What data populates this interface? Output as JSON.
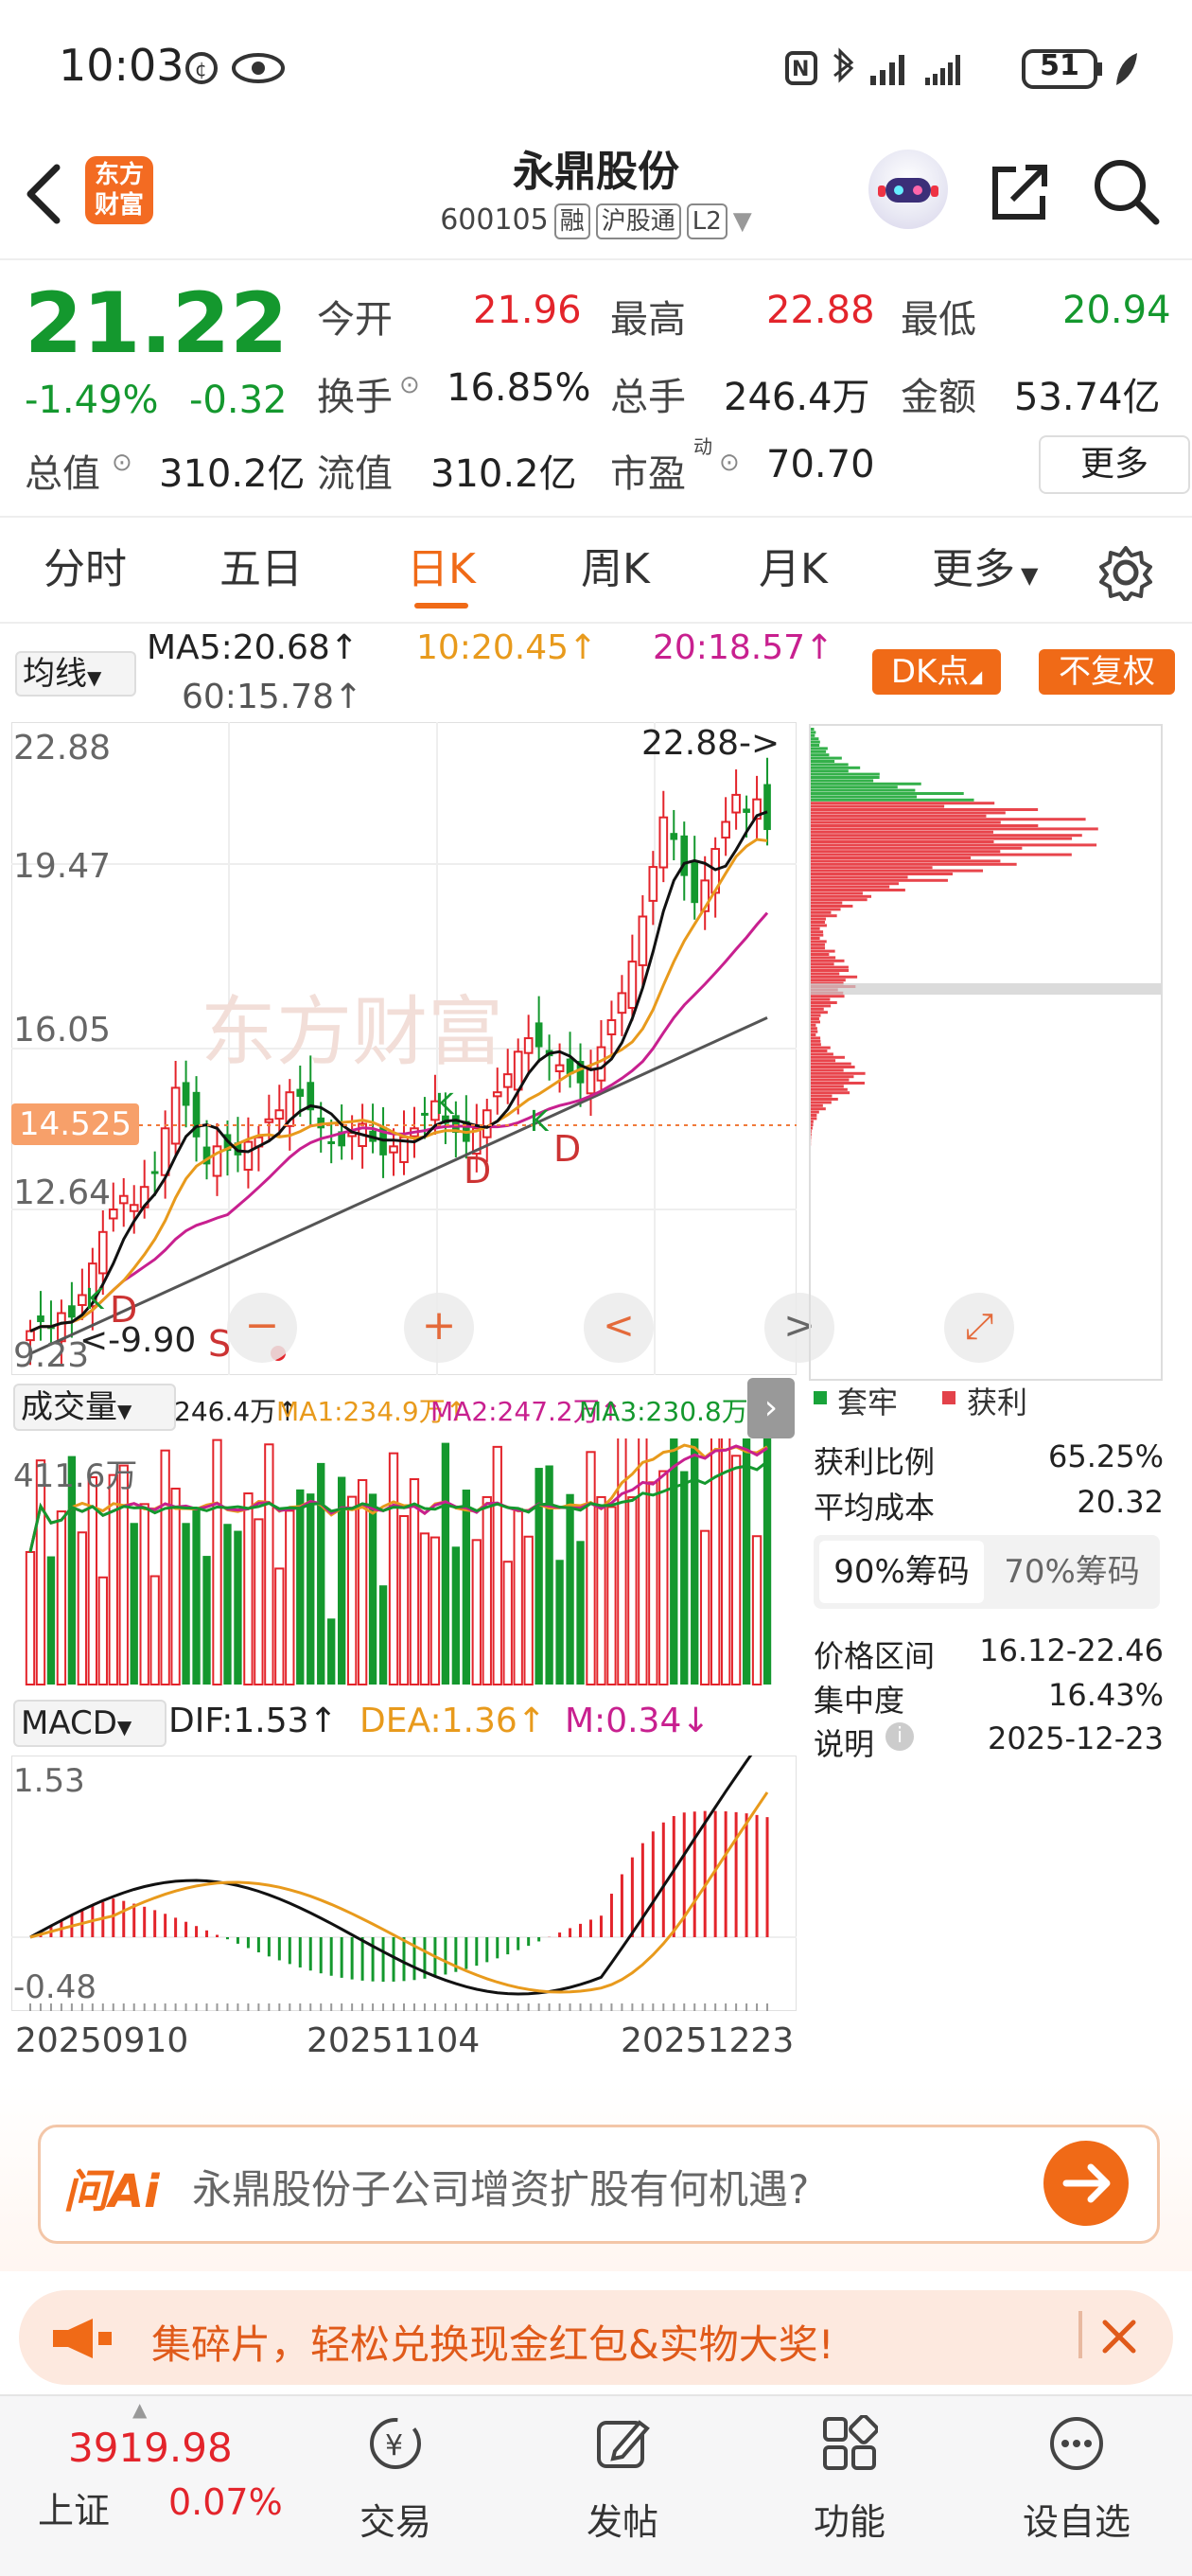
{
  "status": {
    "time": "10:03",
    "battery": "51"
  },
  "header": {
    "title": "永鼎股份",
    "code": "600105",
    "tags": [
      "融",
      "沪股通",
      "L2"
    ],
    "logo_text": "东方\n财富"
  },
  "quote": {
    "price": "21.22",
    "change_pct": "-1.49%",
    "change": "-0.32",
    "open_label": "今开",
    "open": "21.96",
    "high_label": "最高",
    "high": "22.88",
    "low_label": "最低",
    "low": "20.94",
    "turnover_label": "换手",
    "turnover": "16.85%",
    "volume_label": "总手",
    "volume": "246.4万",
    "amount_label": "金额",
    "amount": "53.74亿",
    "mktcap_label": "总值",
    "mktcap": "310.2亿",
    "float_label": "流值",
    "float_val": "310.2亿",
    "pe_label": "市盈",
    "pe_sup": "动",
    "pe": "70.70",
    "more_label": "更多"
  },
  "tabs": [
    "分时",
    "五日",
    "日K",
    "周K",
    "月K",
    "更多"
  ],
  "active_tab": "日K",
  "ma_legend": {
    "select": "均线",
    "ma5": "MA5:20.68↑",
    "ma10": "10:20.45↑",
    "ma20": "20:18.57↑",
    "ma60": "60:15.78↑",
    "dk_label": "DK点",
    "fq_label": "不复权"
  },
  "kline": {
    "y_labels": [
      "22.88",
      "19.47",
      "16.05",
      "12.64",
      "9.23"
    ],
    "current_marker": "14.525",
    "high_note": "22.88->",
    "low_note": "<-9.90",
    "signals": [
      "D",
      "D",
      "D",
      "K",
      "K",
      "K",
      "S"
    ],
    "controls": [
      "−",
      "+",
      "<",
      ">",
      "⤢"
    ]
  },
  "volume_legend": {
    "select": "成交量",
    "vol": "246.4万↑",
    "ma1": "MA1:234.9万↑",
    "ma2": "MA2:247.2万↑",
    "ma3": "MA3:230.8万↑",
    "max_label": "411.6万"
  },
  "macd_legend": {
    "select": "MACD",
    "dif": "DIF:1.53↑",
    "dea": "DEA:1.36↑",
    "m": "M:0.34↓",
    "top": "1.53",
    "bottom": "-0.48"
  },
  "x_dates": [
    "20250910",
    "20251104",
    "20251223"
  ],
  "chips": {
    "legend_trap": "套牢",
    "legend_profit": "获利",
    "profit_ratio_label": "获利比例",
    "profit_ratio": "65.25%",
    "avg_cost_label": "平均成本",
    "avg_cost": "20.32",
    "tab90": "90%筹码",
    "tab70": "70%筹码",
    "range_label": "价格区间",
    "range": "16.12-22.46",
    "conc_label": "集中度",
    "conc": "16.43%",
    "note_label": "说明",
    "note_date": "2025-12-23"
  },
  "ai": {
    "brand": "问Ai",
    "prompt": "永鼎股份子公司增资扩股有何机遇?"
  },
  "promo": {
    "text": "集碎片，轻松兑换现金红包&实物大奖!"
  },
  "bottom": {
    "index_value": "3919.98",
    "index_name": "上证",
    "index_change": "0.07%",
    "nav": [
      "交易",
      "发帖",
      "功能",
      "设自选"
    ]
  },
  "colors": {
    "up": "#e3242b",
    "down": "#14982e",
    "accent": "#f06a17",
    "ma5": "#111111",
    "ma10": "#e89a1c",
    "ma20": "#c8208f",
    "ma60": "#555555"
  }
}
